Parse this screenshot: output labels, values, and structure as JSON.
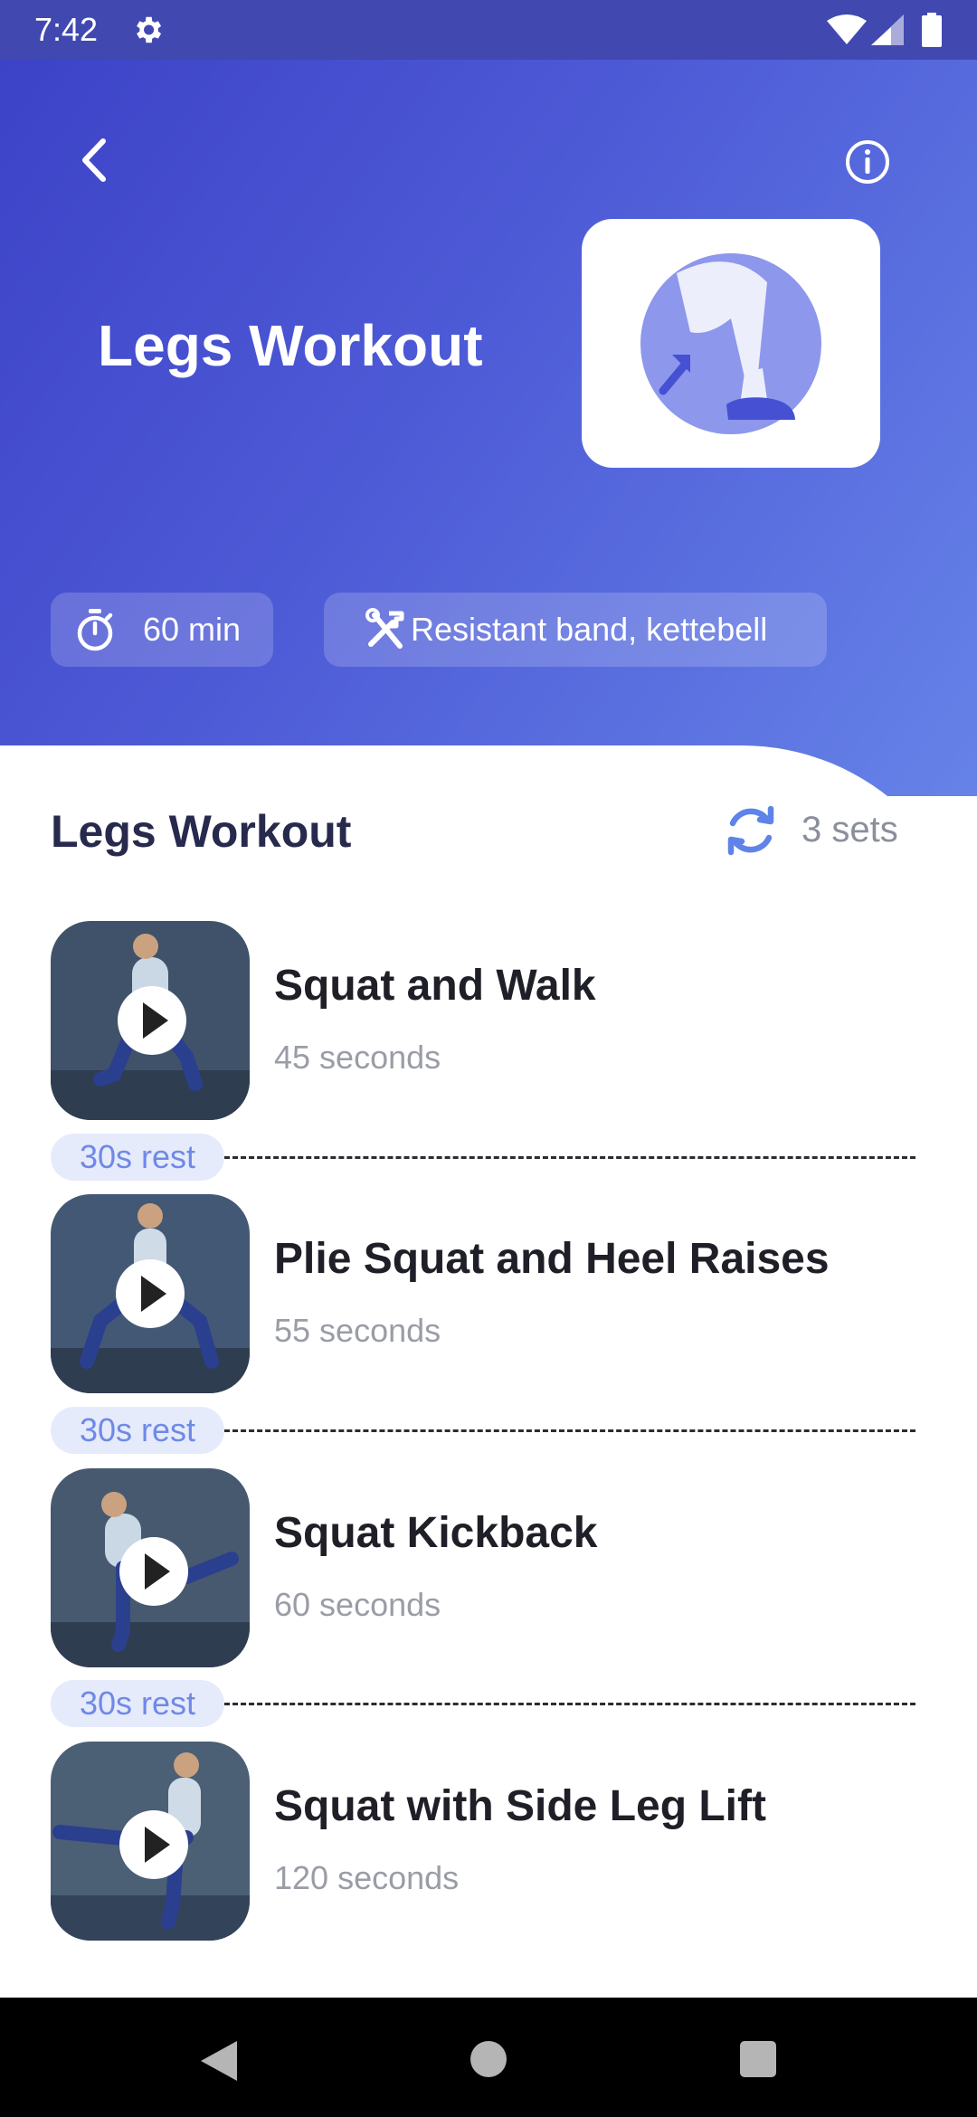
{
  "status_bar": {
    "time": "7:42"
  },
  "header": {
    "title": "Legs Workout",
    "duration": "60 min",
    "equipment": "Resistant band, kettebell"
  },
  "workout": {
    "title": "Legs Workout",
    "sets": "3 sets",
    "exercises": [
      {
        "name": "Squat and Walk",
        "duration": "45 seconds"
      },
      {
        "name": "Plie Squat and Heel Raises",
        "duration": "55 seconds"
      },
      {
        "name": "Squat Kickback",
        "duration": "60 seconds"
      },
      {
        "name": "Squat with Side Leg Lift",
        "duration": "120 seconds"
      }
    ],
    "rests": [
      "30s rest",
      "30s rest",
      "30s rest"
    ]
  },
  "colors": {
    "header_gradient_start": "#3c41c6",
    "header_gradient_end": "#6683e8",
    "accent": "#6f89e6",
    "title_text": "#272a4d"
  }
}
